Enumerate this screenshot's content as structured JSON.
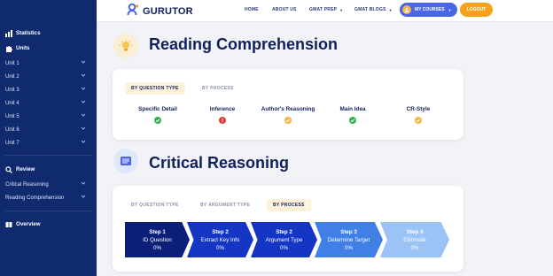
{
  "brand": {
    "name": "GURUTOR"
  },
  "nav": {
    "home": "HOME",
    "about": "ABOUT US",
    "gmat_prep": "GMAT PREP",
    "gmat_blogs": "GMAT BLOGS",
    "my_courses": "MY COURSES",
    "logout": "LOGOUT"
  },
  "sidebar": {
    "statistics": "Statistics",
    "units": "Units",
    "unit_items": [
      "Unit 1",
      "Unit 2",
      "Unit 3",
      "Unit 4",
      "Unit 5",
      "Unit 6",
      "Unit 7"
    ],
    "review": "Review",
    "review_items": [
      "Critical Reasoning",
      "Reading Comprehension"
    ],
    "overview": "Overview"
  },
  "rc": {
    "title": "Reading Comprehension",
    "tabs": [
      "BY QUESTION TYPE",
      "BY PROCESS"
    ],
    "categories": [
      {
        "label": "Specific Detail",
        "status": "correct"
      },
      {
        "label": "Inference",
        "status": "wrong"
      },
      {
        "label": "Author's Reasoning",
        "status": "partial"
      },
      {
        "label": "Main Idea",
        "status": "correct"
      },
      {
        "label": "CR-Style",
        "status": "partial"
      }
    ]
  },
  "cr": {
    "title": "Critical Reasoning",
    "tabs": [
      "BY QUESTION TYPE",
      "BY ARGUMENT TYPE",
      "BY PROCESS"
    ],
    "steps": [
      {
        "step": "Step 1",
        "name": "ID Question",
        "pct": "0%"
      },
      {
        "step": "Step 2",
        "name": "Extract Key Info",
        "pct": "0%"
      },
      {
        "step": "Step 2",
        "name": "Argument Type",
        "pct": "0%"
      },
      {
        "step": "Step 3",
        "name": "Determine Target",
        "pct": "0%"
      },
      {
        "step": "Step 4",
        "name": "Eliminate",
        "pct": "0%"
      }
    ]
  },
  "colors": {
    "sidebar": "#0f2a6d",
    "correct": "#2fb24c",
    "wrong": "#e03b2e",
    "partial": "#f4b73a",
    "step_dark": "#0c1f78",
    "step_mid": "#1535c4",
    "step_light": "#3f7fe6",
    "step_pale": "#9cc3f5"
  }
}
